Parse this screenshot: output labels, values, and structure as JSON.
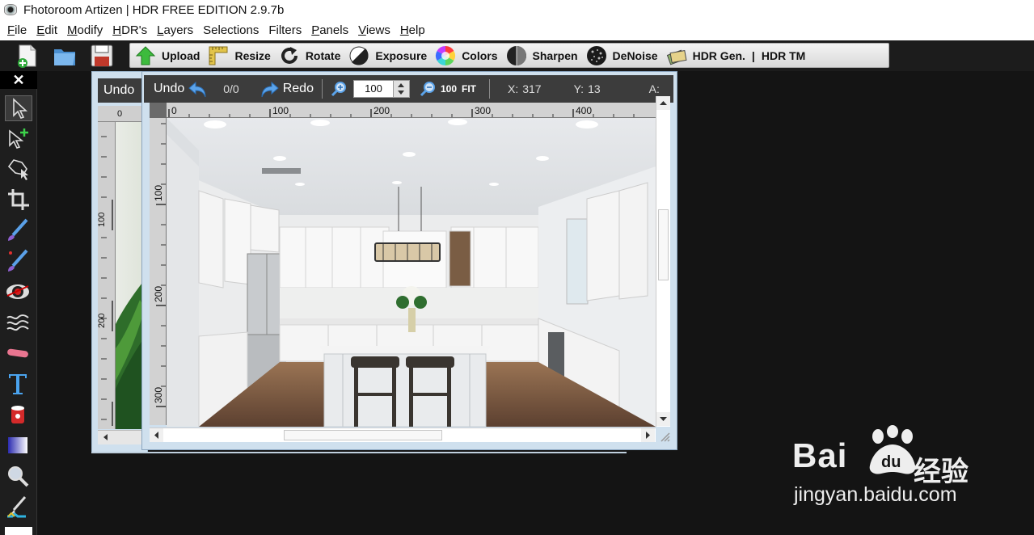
{
  "window": {
    "title": "Fhotoroom Artizen | HDR FREE EDITION 2.9.7b"
  },
  "menu": [
    {
      "label": "File",
      "acc": "F",
      "rest": "ile"
    },
    {
      "label": "Edit",
      "acc": "E",
      "rest": "dit"
    },
    {
      "label": "Modify",
      "acc": "M",
      "rest": "odify"
    },
    {
      "label": "HDR's",
      "acc": "H",
      "rest": "DR's"
    },
    {
      "label": "Layers",
      "acc": "L",
      "rest": "ayers"
    },
    {
      "label": "Selections",
      "acc": "S",
      "rest": "elections"
    },
    {
      "label": "Filters",
      "acc": "F",
      "rest": "ilters"
    },
    {
      "label": "Panels",
      "acc": "P",
      "rest": "anels"
    },
    {
      "label": "Views",
      "acc": "V",
      "rest": "iews"
    },
    {
      "label": "Help",
      "acc": "H",
      "rest": "elp"
    }
  ],
  "toolbar": {
    "buttons": [
      {
        "label": "Upload",
        "icon": "upload-arrow-icon"
      },
      {
        "label": "Resize",
        "icon": "ruler-resize-icon"
      },
      {
        "label": "Rotate",
        "icon": "rotate-icon"
      },
      {
        "label": "Exposure",
        "icon": "exposure-icon"
      },
      {
        "label": "Colors",
        "icon": "color-wheel-icon"
      },
      {
        "label": "Sharpen",
        "icon": "sharpen-icon"
      },
      {
        "label": "DeNoise",
        "icon": "denoise-icon"
      }
    ],
    "hdr_gen": "HDR Gen.",
    "sep": "|",
    "hdr_tm": "HDR TM"
  },
  "palette": {
    "close": "✕"
  },
  "back_window": {
    "undo": "Undo",
    "ruler_zero": "0"
  },
  "image_window": {
    "undo": "Undo",
    "history_count": "0/0",
    "redo": "Redo",
    "zoom_value": "100",
    "zoom_100": "100",
    "zoom_fit": "FIT",
    "x_label": "X:",
    "x_value": "317",
    "y_label": "Y:",
    "y_value": "13",
    "a_label": "A:",
    "ruler_top": [
      "0",
      "100",
      "200",
      "300",
      "400"
    ],
    "ruler_left": [
      "100",
      "200",
      "300"
    ]
  },
  "watermark": {
    "brand": "Bai",
    "brand2": "du",
    "cn": "经验",
    "url": "jingyan.baidu.com"
  }
}
